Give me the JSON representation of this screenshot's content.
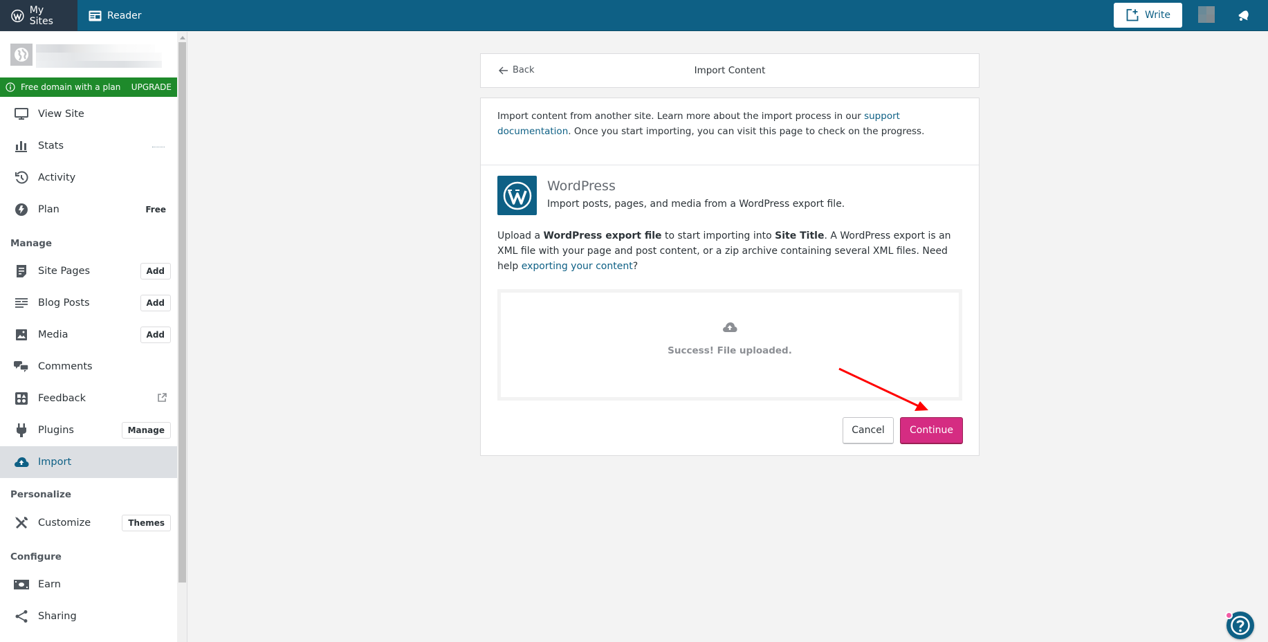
{
  "masterbar": {
    "my_sites": "My Sites",
    "reader": "Reader",
    "write": "Write"
  },
  "sidebar": {
    "upsell": {
      "text": "Free domain with a plan",
      "action": "UPGRADE"
    },
    "items": [
      {
        "label": "View Site",
        "icon": "monitor-icon"
      },
      {
        "label": "Stats",
        "icon": "stats-icon"
      },
      {
        "label": "Activity",
        "icon": "history-icon"
      },
      {
        "label": "Plan",
        "icon": "plan-icon",
        "badge": "Free"
      }
    ],
    "sections": [
      {
        "heading": "Manage",
        "items": [
          {
            "label": "Site Pages",
            "icon": "page-icon",
            "button": "Add"
          },
          {
            "label": "Blog Posts",
            "icon": "posts-icon",
            "button": "Add"
          },
          {
            "label": "Media",
            "icon": "image-icon",
            "button": "Add"
          },
          {
            "label": "Comments",
            "icon": "comments-icon"
          },
          {
            "label": "Feedback",
            "icon": "feedback-icon",
            "external": true
          },
          {
            "label": "Plugins",
            "icon": "plugins-icon",
            "button": "Manage"
          },
          {
            "label": "Import",
            "icon": "cloud-upload-icon",
            "selected": true
          }
        ]
      },
      {
        "heading": "Personalize",
        "items": [
          {
            "label": "Customize",
            "icon": "tools-icon",
            "button": "Themes"
          }
        ]
      },
      {
        "heading": "Configure",
        "items": [
          {
            "label": "Earn",
            "icon": "money-icon"
          },
          {
            "label": "Sharing",
            "icon": "share-icon"
          }
        ]
      }
    ]
  },
  "header": {
    "back": "Back",
    "title": "Import Content"
  },
  "intro": {
    "text_before": "Import content from another site. Learn more about the import process in our ",
    "link": "support documentation",
    "text_after": ". Once you start importing, you can visit this page to check on the progress."
  },
  "importer": {
    "title": "WordPress",
    "description": "Import posts, pages, and media from a WordPress export file.",
    "upload_p1": "Upload a ",
    "upload_b1": "WordPress export file",
    "upload_p2": " to start importing into ",
    "upload_b2": "Site Title",
    "upload_p3": ". A WordPress export is an XML file with your page and post content, or a zip archive containing several XML files. Need help ",
    "upload_link": "exporting your content",
    "upload_p4": "?",
    "status": "Success! File uploaded.",
    "cancel": "Cancel",
    "continue": "Continue"
  },
  "colors": {
    "masterbar": "#0e6085",
    "accent": "#d52c82",
    "upsell": "#1e8a2b",
    "annotation_arrow": "#ff0000"
  }
}
